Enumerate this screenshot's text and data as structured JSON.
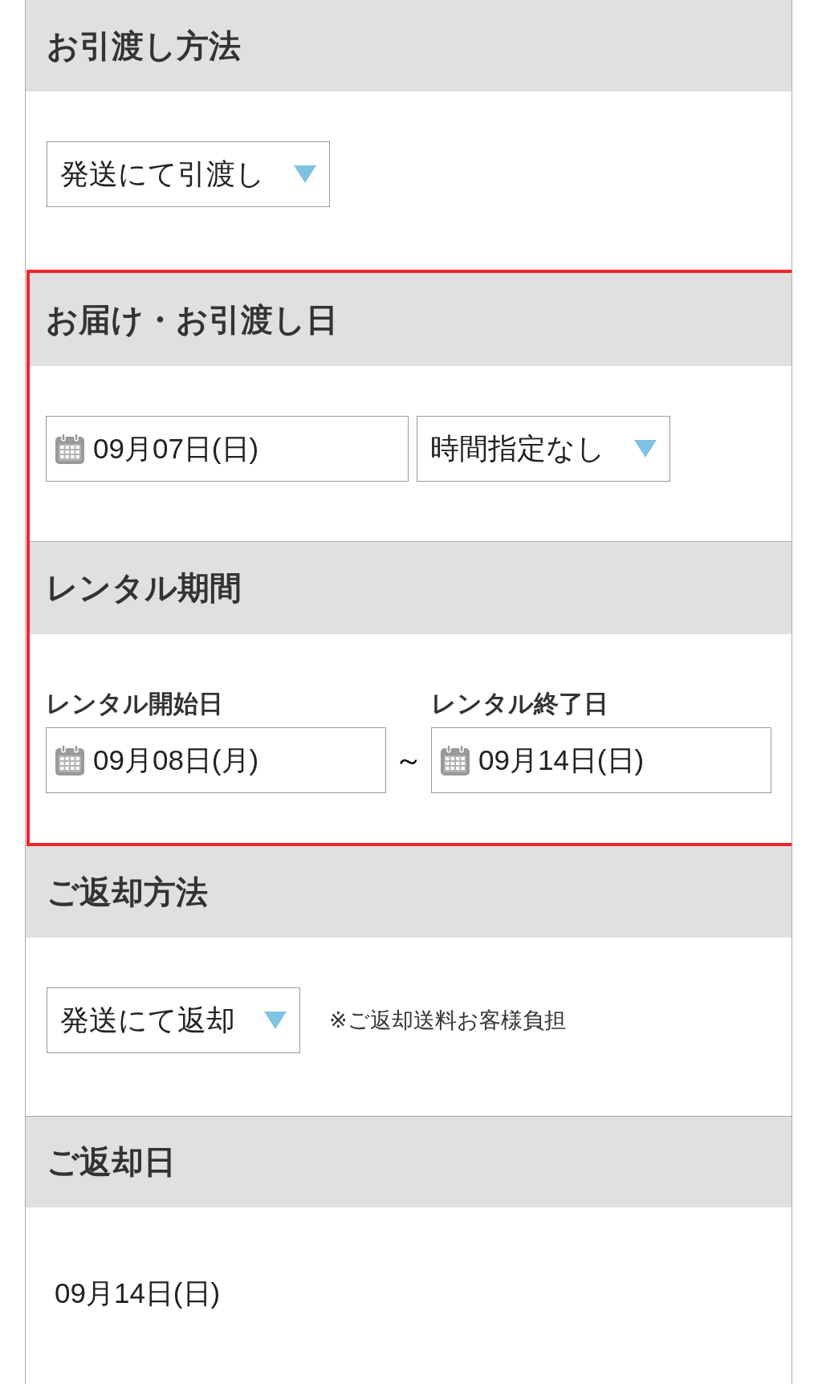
{
  "blocks": [
    {
      "highlighted": false,
      "sections": [
        {
          "heading": "お引渡し方法",
          "kind": "select",
          "select": {
            "value": "発送にて引渡し"
          }
        }
      ]
    },
    {
      "highlighted": true,
      "sections": [
        {
          "heading": "お届け・お引渡し日",
          "kind": "date_time",
          "date": "09月07日(日)",
          "time_select": {
            "value": "時間指定なし"
          }
        },
        {
          "heading": "レンタル期間",
          "kind": "range",
          "start_label": "レンタル開始日",
          "start_date": "09月08日(月)",
          "separator": "～",
          "end_label": "レンタル終了日",
          "end_date": "09月14日(日)"
        }
      ]
    },
    {
      "highlighted": false,
      "sections": [
        {
          "heading": "ご返却方法",
          "kind": "select",
          "select": {
            "value": "発送にて返却"
          },
          "note": "※ご返却送料お客様負担"
        },
        {
          "heading": "ご返却日",
          "kind": "text",
          "value": "09月14日(日)"
        }
      ]
    }
  ]
}
